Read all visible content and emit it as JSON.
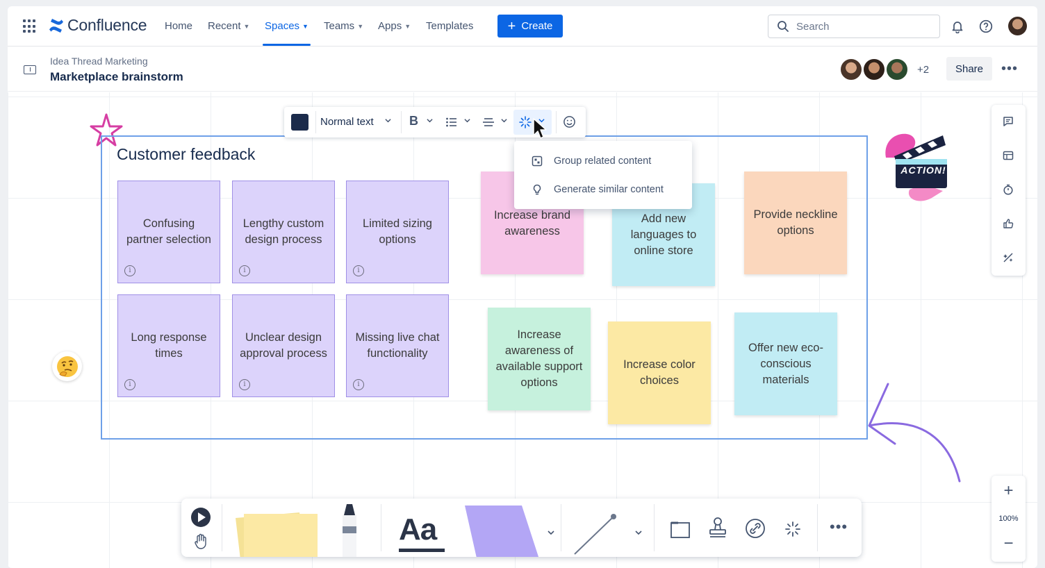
{
  "app": {
    "name": "Confluence",
    "icons": [
      "app-switcher-icon",
      "confluence-logo-icon",
      "search-icon",
      "bell-icon",
      "help-icon"
    ]
  },
  "nav": {
    "items": [
      {
        "label": "Home",
        "dropdown": false
      },
      {
        "label": "Recent",
        "dropdown": true
      },
      {
        "label": "Spaces",
        "dropdown": true,
        "active": true
      },
      {
        "label": "Teams",
        "dropdown": true
      },
      {
        "label": "Apps",
        "dropdown": true
      },
      {
        "label": "Templates",
        "dropdown": false
      }
    ],
    "create_label": "Create",
    "search_placeholder": "Search",
    "accent": "#0c66e4"
  },
  "page": {
    "space": "Idea Thread Marketing",
    "title": "Marketplace brainstorm",
    "collaborators_extra": "+2",
    "share_label": "Share"
  },
  "toolbar": {
    "color_swatch": "#1b2b4b",
    "text_style": "Normal text",
    "bold_glyph": "B",
    "ai_menu": [
      {
        "label": "Group related content",
        "icon": "group-icon"
      },
      {
        "label": "Generate similar content",
        "icon": "lightbulb-icon"
      }
    ]
  },
  "board": {
    "section_title": "Customer feedback",
    "stickies": [
      {
        "text": "Confusing partner selection",
        "color": "purple",
        "info": true
      },
      {
        "text": "Lengthy custom design process",
        "color": "purple",
        "info": true
      },
      {
        "text": "Limited sizing options",
        "color": "purple",
        "info": true
      },
      {
        "text": "Long response times",
        "color": "purple",
        "info": true
      },
      {
        "text": "Unclear design approval process",
        "color": "purple",
        "info": true
      },
      {
        "text": "Missing live chat functionality",
        "color": "purple",
        "info": true
      },
      {
        "text": "Increase brand awareness",
        "color": "pink"
      },
      {
        "text": "Add new languages to online store",
        "color": "teal"
      },
      {
        "text": "Provide neckline options",
        "color": "peach"
      },
      {
        "text": "Increase awareness of available support options",
        "color": "mint"
      },
      {
        "text": "Increase color choices",
        "color": "yellow"
      },
      {
        "text": "Offer new eco-conscious materials",
        "color": "teal"
      }
    ],
    "sticker_text": "ACTION!",
    "colors": {
      "purple": "#dcd3fb",
      "pink": "#f7c6e8",
      "teal": "#c1ecf4",
      "peach": "#fbd7bd",
      "mint": "#c6f1dd",
      "yellow": "#fce9a4"
    }
  },
  "zoom": {
    "level": "100%",
    "plus": "+",
    "minus": "−"
  },
  "right_tools": [
    "comment-icon",
    "table-icon",
    "timer-icon",
    "vote-icon",
    "ai-tool-icon"
  ],
  "bottom_tools": {
    "text_tool_label": "Aa",
    "more": "•••"
  }
}
